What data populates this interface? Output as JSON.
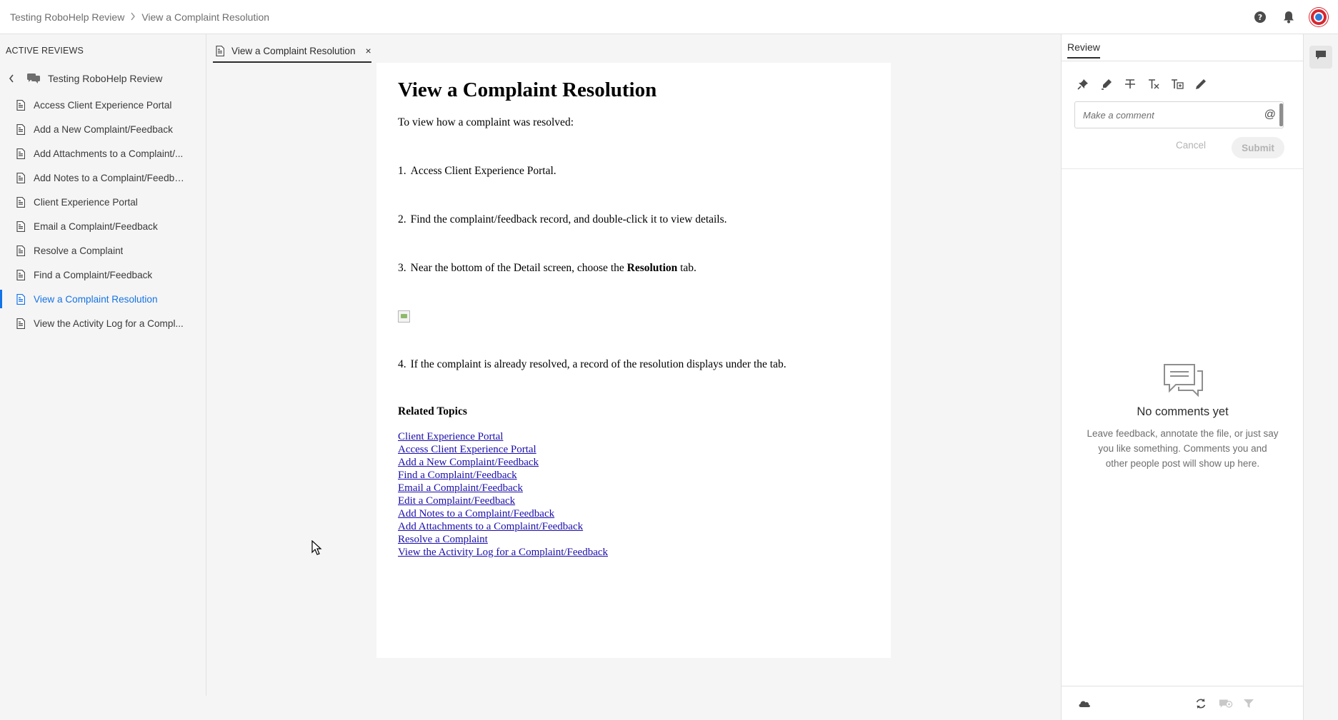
{
  "breadcrumb": {
    "root": "Testing RoboHelp Review",
    "separator": ">",
    "current": "View a Complaint Resolution"
  },
  "sidebar": {
    "heading": "ACTIVE REVIEWS",
    "review_name": "Testing RoboHelp Review",
    "items": [
      {
        "label": "Access Client Experience Portal",
        "active": false
      },
      {
        "label": "Add a New Complaint/Feedback",
        "active": false
      },
      {
        "label": "Add Attachments to a Complaint/...",
        "active": false
      },
      {
        "label": "Add Notes to a Complaint/Feedba...",
        "active": false
      },
      {
        "label": "Client Experience Portal",
        "active": false
      },
      {
        "label": "Email a Complaint/Feedback",
        "active": false
      },
      {
        "label": "Resolve a Complaint",
        "active": false
      },
      {
        "label": "Find a Complaint/Feedback",
        "active": false
      },
      {
        "label": "View a Complaint Resolution",
        "active": true
      },
      {
        "label": "View the Activity Log for a Compl...",
        "active": false
      }
    ]
  },
  "tab": {
    "label": "View a Complaint Resolution",
    "close": "×"
  },
  "document": {
    "title": "View a Complaint Resolution",
    "intro": "To view how a complaint was resolved:",
    "steps": {
      "s1_num": "1.",
      "s1_text": "Access Client Experience Portal.",
      "s2_num": "2.",
      "s2_text": "Find the complaint/feedback record, and double-click it to view details.",
      "s3_num": "3.",
      "s3_pre": "Near the bottom of the Detail screen, choose the ",
      "s3_bold": "Resolution",
      "s3_post": " tab.",
      "s4_num": "4.",
      "s4_text": "If the complaint is already resolved, a record of the resolution displays under the tab."
    },
    "related_heading": "Related Topics",
    "related_links": [
      "Client Experience Portal",
      "Access Client Experience Portal",
      "Add a New Complaint/Feedback",
      "Find a Complaint/Feedback",
      "Email a Complaint/Feedback",
      "Edit a Complaint/Feedback",
      "Add Notes to a Complaint/Feedback",
      "Add Attachments to a Complaint/Feedback",
      "Resolve a Complaint",
      "View the Activity Log for a Complaint/Feedback"
    ]
  },
  "review_panel": {
    "tab_label": "Review",
    "tools": [
      "pin-icon",
      "highlight-icon",
      "strikethrough-icon",
      "replace-text-icon",
      "insert-text-icon",
      "pencil-icon"
    ],
    "comment_placeholder": "Make a comment",
    "mention": "@",
    "cancel_label": "Cancel",
    "submit_label": "Submit",
    "empty_title": "No comments yet",
    "empty_description": "Leave feedback, annotate the file, or just say you like something. Comments you and other people post will show up here."
  },
  "top_icons": [
    "help-icon",
    "bell-icon",
    "avatar"
  ],
  "colors": {
    "accent": "#1473e6",
    "link": "#1a0dab",
    "avatar": "#d7262f"
  }
}
